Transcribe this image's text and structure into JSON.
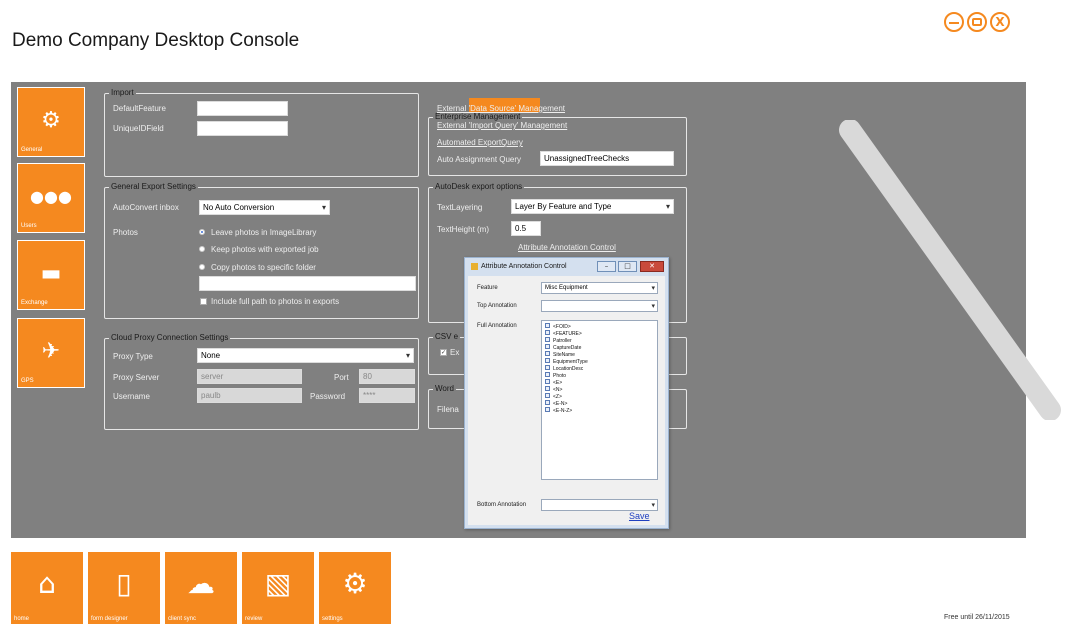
{
  "app": {
    "title": "Demo Company Desktop Console"
  },
  "window_controls": {
    "minimize": "",
    "maximize": "",
    "close": "X"
  },
  "colors": {
    "accent": "#f5891f",
    "panel": "#808080",
    "dialog": "#d4e0ef"
  },
  "sidebar": {
    "tiles": [
      {
        "label": "General",
        "icon": "gear-icon",
        "glyph": "✿"
      },
      {
        "label": "Users",
        "icon": "users-icon",
        "glyph": "👥"
      },
      {
        "label": "Exchange",
        "icon": "folder-icon",
        "glyph": "🗂"
      },
      {
        "label": "GPS",
        "icon": "satellite-icon",
        "glyph": "🛰"
      }
    ]
  },
  "import": {
    "legend": "Import",
    "default_feature_label": "DefaultFeature",
    "default_feature_value": "",
    "unique_id_label": "UniqueIDField",
    "unique_id_value": ""
  },
  "general_export": {
    "legend": "General Export Settings",
    "auto_convert_label": "AutoConvert inbox",
    "auto_convert_value": "No Auto Conversion",
    "photos_label": "Photos",
    "photo_options": [
      "Leave photos in ImageLibrary",
      "Keep photos with exported job",
      "Copy photos to specific folder"
    ],
    "folder_value": "",
    "include_paths_label": "Include full path to photos in exports"
  },
  "cloud_proxy": {
    "legend": "Cloud Proxy Connection Settings",
    "proxy_type_label": "Proxy Type",
    "proxy_type_value": "None",
    "proxy_server_label": "Proxy Server",
    "proxy_server_value": "server",
    "port_label": "Port",
    "port_value": "80",
    "username_label": "Username",
    "username_value": "paulb",
    "password_label": "Password",
    "password_value": "****"
  },
  "enterprise": {
    "legend": "Enterprise Management",
    "links": [
      "External 'Data Source' Management",
      "External 'Import Query' Management",
      "Automated ExportQuery"
    ],
    "auto_assign_label": "Auto Assignment Query",
    "auto_assign_value": "UnassignedTreeChecks"
  },
  "autodesk": {
    "legend": "AutoDesk export options",
    "text_layering_label": "TextLayering",
    "text_layering_value": "Layer By Feature and Type",
    "text_height_label": "TextHeight (m)",
    "text_height_value": "0.5",
    "annotation_link": "Attribute Annotation Control"
  },
  "csv": {
    "legend": "CSV e",
    "check_label": "Ex"
  },
  "word": {
    "legend": "Word",
    "filename_label": "Filena"
  },
  "dialog": {
    "title": "Attribute Annotation Control",
    "feature_label": "Feature",
    "feature_value": "Misc Equipment",
    "top_annotation_label": "Top Annotation",
    "top_annotation_value": "",
    "full_annotation_label": "Full Annotation",
    "full_annotation_items": [
      "<FOID>",
      "<FEATURE>",
      "Patroller",
      "CaptureDate",
      "SiteName",
      "EquipmentType",
      "LocationDesc",
      "Photo",
      "<E>",
      "<N>",
      "<Z>",
      "<E-N>",
      "<E-N-Z>"
    ],
    "bottom_annotation_label": "Bottom Annotation",
    "bottom_annotation_value": "",
    "save_label": "Save"
  },
  "bottom_toolbar": {
    "tiles": [
      {
        "label": "home",
        "icon": "home-icon",
        "glyph": "⌂"
      },
      {
        "label": "form designer",
        "icon": "clipboard-icon",
        "glyph": "📋"
      },
      {
        "label": "client sync",
        "icon": "cloud-sync-icon",
        "glyph": "☁"
      },
      {
        "label": "review",
        "icon": "map-icon",
        "glyph": "🗺"
      },
      {
        "label": "settings",
        "icon": "gear-icon",
        "glyph": "⚙"
      }
    ]
  },
  "footer": {
    "free_until": "Free until 26/11/2015"
  }
}
